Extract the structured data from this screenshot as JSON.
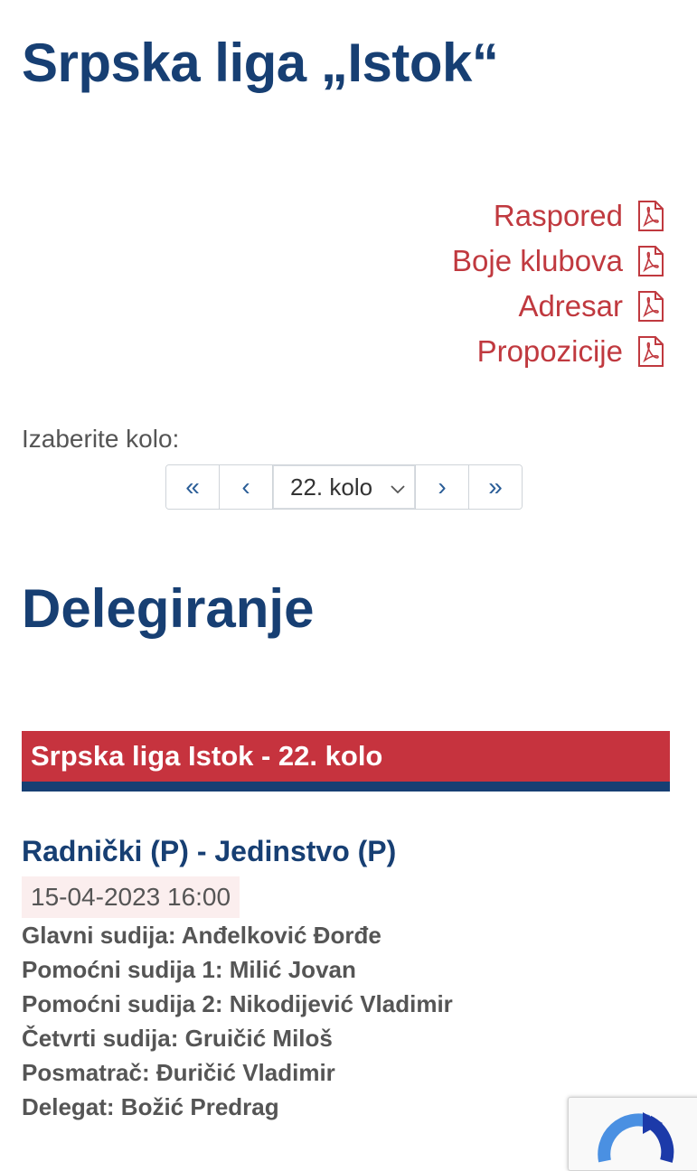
{
  "header": {
    "title": "Srpska liga „Istok“"
  },
  "documents": [
    {
      "label": "Raspored",
      "icon": "pdf-icon"
    },
    {
      "label": "Boje klubova",
      "icon": "pdf-icon"
    },
    {
      "label": "Adresar",
      "icon": "pdf-icon"
    },
    {
      "label": "Propozicije",
      "icon": "pdf-icon"
    }
  ],
  "round_selector": {
    "label": "Izaberite kolo:",
    "first": "«",
    "prev": "‹",
    "selected": "22. kolo",
    "next": "›",
    "last": "»"
  },
  "section": {
    "title": "Delegiranje",
    "banner": "Srpska liga Istok - 22. kolo"
  },
  "match": {
    "title": "Radnički (P) - Jedinstvo (P)",
    "datetime": "15-04-2023 16:00",
    "officials": [
      "Glavni sudija: Anđelković Đorđe",
      "Pomoćni sudija 1: Milić Jovan",
      "Pomoćni sudija 2: Nikodijević Vladimir",
      "Četvrti sudija: Gruičić Miloš",
      "Posmatrač: Đuričić Vladimir",
      "Delegat: Božić Predrag"
    ]
  },
  "colors": {
    "primary_blue": "#173f73",
    "accent_red": "#c6333e",
    "link_red": "#c0393f",
    "text_gray": "#555555"
  },
  "widgets": {
    "captcha_icon": "recaptcha-icon"
  }
}
